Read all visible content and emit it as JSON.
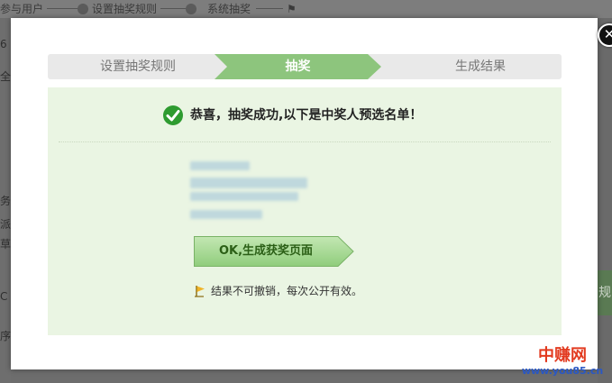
{
  "background": {
    "crumbs": [
      "参与用户",
      "设置抽奖规则",
      "系统抽奖"
    ],
    "left_fragments": [
      "6",
      "全",
      "务乡",
      "派",
      "草",
      "C",
      "序"
    ],
    "right_tab": "规"
  },
  "dialog": {
    "close_symbol": "✕",
    "steps": [
      {
        "label": "设置抽奖规则",
        "state": "done"
      },
      {
        "label": "抽奖",
        "state": "active"
      },
      {
        "label": "生成结果",
        "state": "pending"
      }
    ],
    "success_message": "恭喜，抽奖成功,以下是中奖人预选名单！",
    "confirm_button": "OK,生成获奖页面",
    "note": "结果不可撤销，每次公开有效。"
  },
  "watermark": {
    "title": "中赚网",
    "url": "www.you85.cn"
  },
  "colors": {
    "active_step": "#8dc57d",
    "panel": "#eaf5e3",
    "check": "#2e9b30",
    "button": "#9fd48c"
  }
}
